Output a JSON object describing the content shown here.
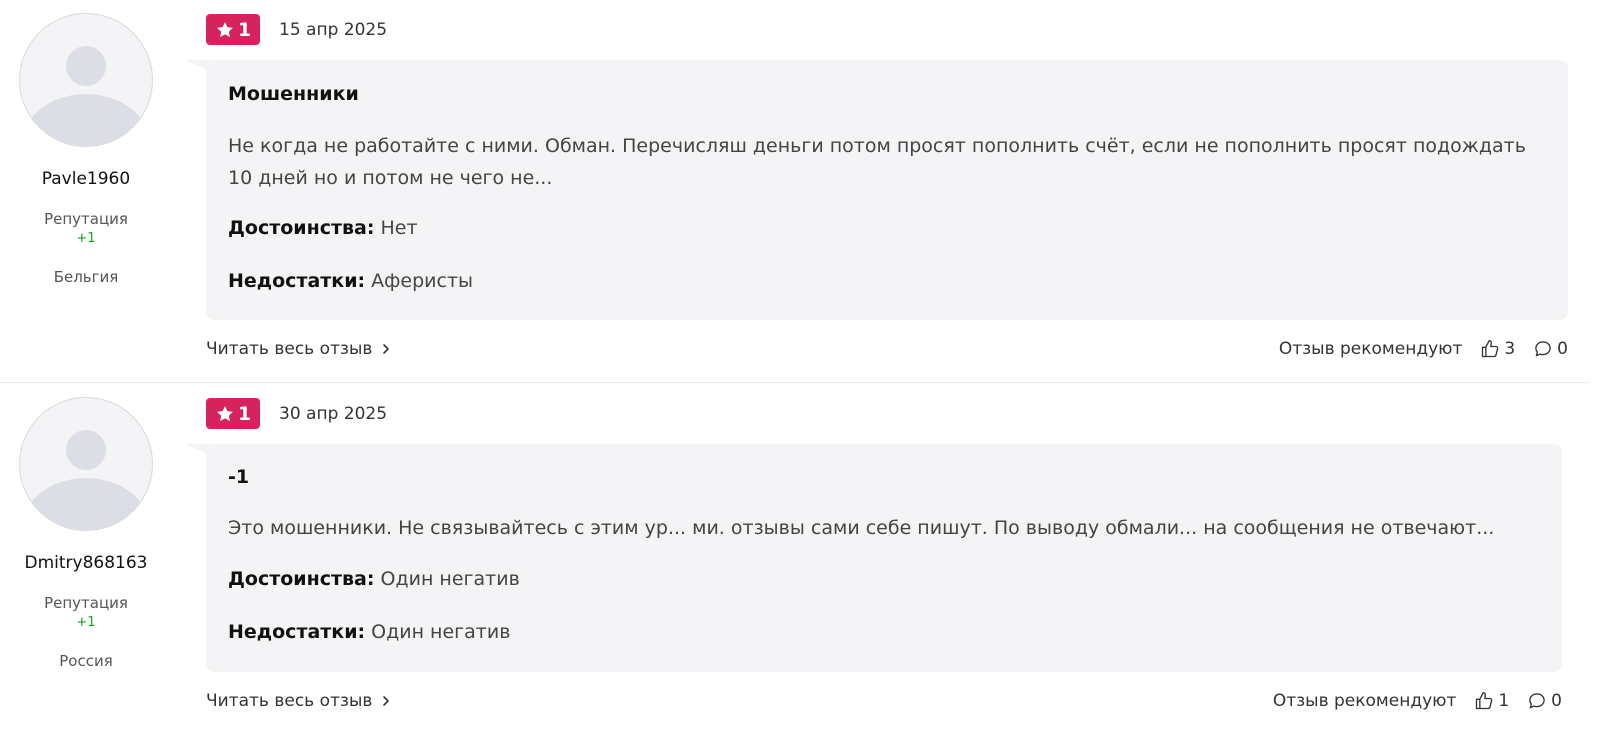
{
  "reviews": [
    {
      "author": {
        "username": "Pavle1960",
        "reputation_label": "Репутация",
        "reputation_value": "+1",
        "country": "Бельгия"
      },
      "rating": "1",
      "date": "15 апр 2025",
      "title": "Мошенники",
      "text": "Не когда не работайте с ними. Обман. Перечисляш деньги потом просят пополнить счёт, если не пополнить просят подождать 10 дней но и потом не чего не...",
      "pros_label": "Достоинства:",
      "pros": "Нет",
      "cons_label": "Недостатки:",
      "cons": "Аферисты",
      "read_more": "Читать весь отзыв",
      "recommend_label": "Отзыв рекомендуют",
      "likes": "3",
      "comments": "0"
    },
    {
      "author": {
        "username": "Dmitry868163",
        "reputation_label": "Репутация",
        "reputation_value": "+1",
        "country": "Россия"
      },
      "rating": "1",
      "date": "30 апр 2025",
      "title": "-1",
      "text": "Это мошенники. Не связывайтесь с этим ур... ми. отзывы сами себе пишут. По выводу обмали... на сообщения не отвечают...",
      "pros_label": "Достоинства:",
      "pros": "Один негатив",
      "cons_label": "Недостатки:",
      "cons": "Один негатив",
      "read_more": "Читать весь отзыв",
      "recommend_label": "Отзыв рекомендуют",
      "likes": "1",
      "comments": "0"
    }
  ],
  "colors": {
    "badge": "#d6235e",
    "card_bg": "#f4f4f6",
    "reputation": "#1aa31a"
  }
}
